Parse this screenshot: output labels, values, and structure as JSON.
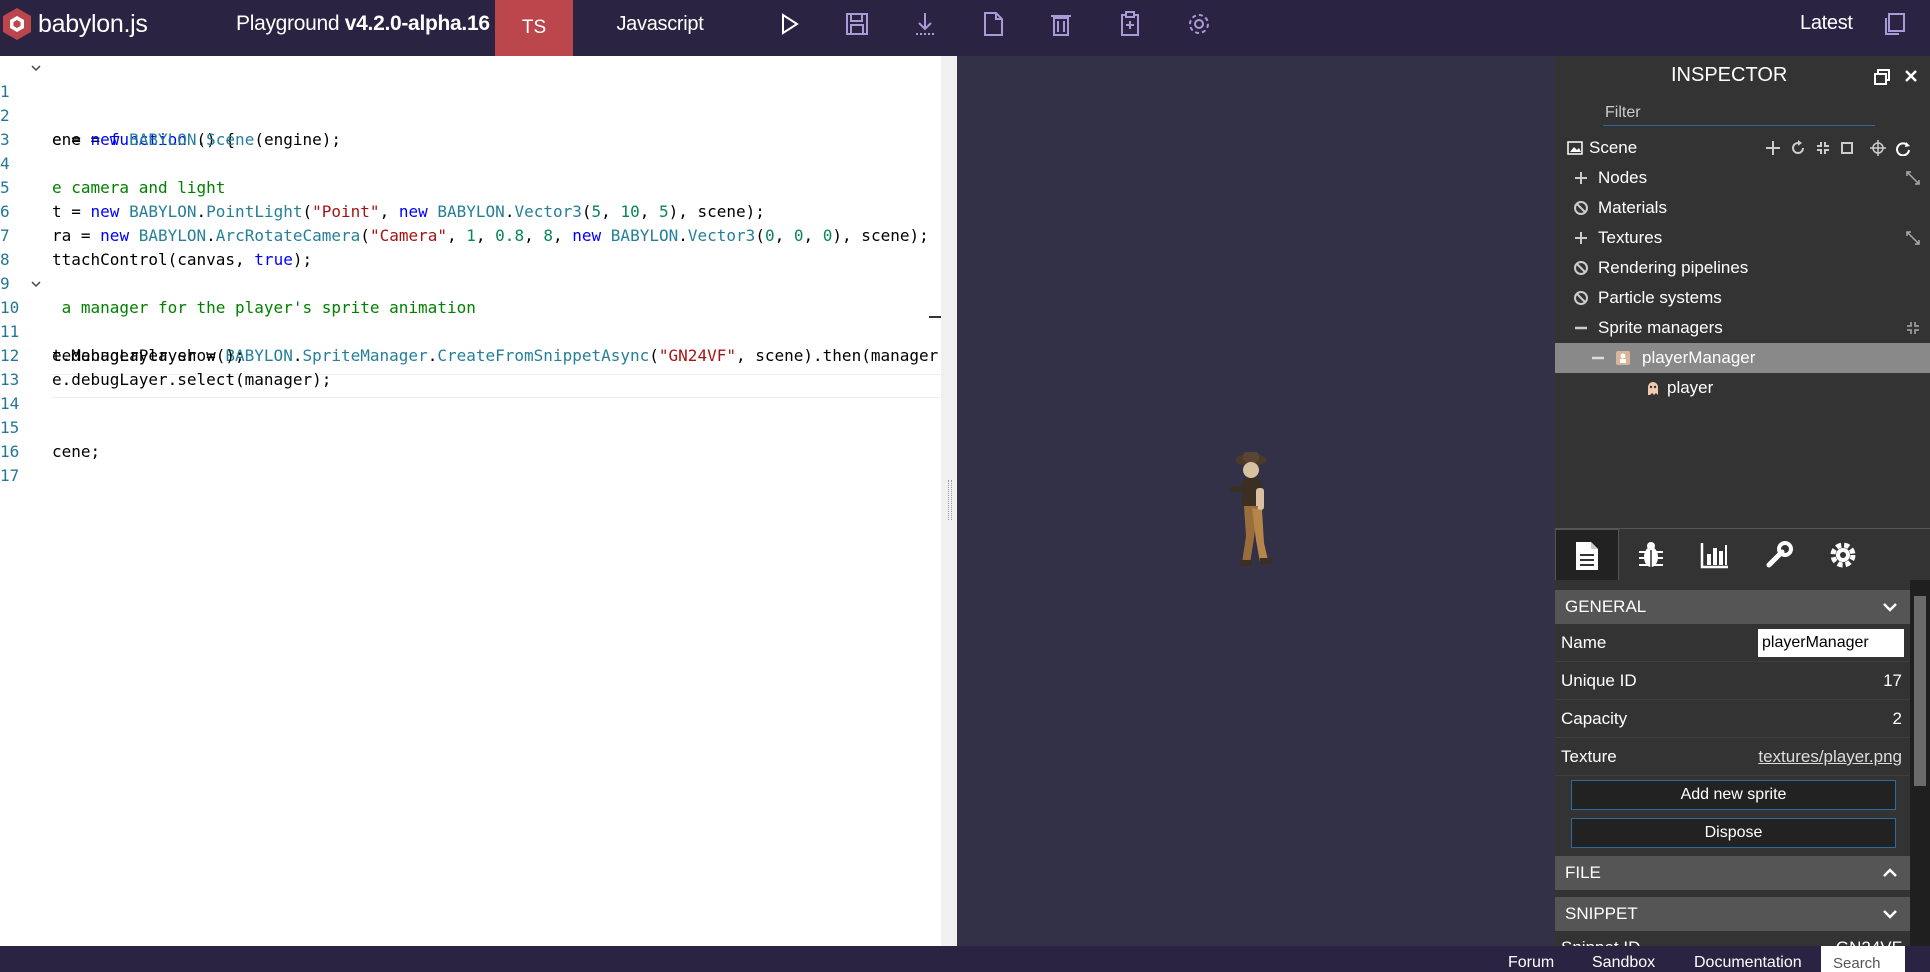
{
  "topbar": {
    "logo_text": "babylon.js",
    "title_prefix": "Playground ",
    "title_version": "v4.2.0-alpha.16",
    "tab_ts": "TS",
    "tab_js": "Javascript",
    "latest": "Latest",
    "icons": [
      "play-icon",
      "save-icon",
      "download-icon",
      "new-file-icon",
      "clear-icon",
      "examples-icon",
      "settings-icon",
      "copy-icon"
    ]
  },
  "editor": {
    "lines": [
      {
        "n": "1",
        "fold": true
      },
      {
        "n": "2",
        "fold": false
      },
      {
        "n": "3",
        "fold": false
      },
      {
        "n": "4",
        "fold": false
      },
      {
        "n": "5",
        "fold": false
      },
      {
        "n": "6",
        "fold": false
      },
      {
        "n": "7",
        "fold": false
      },
      {
        "n": "8",
        "fold": false
      },
      {
        "n": "9",
        "fold": false
      },
      {
        "n": "10",
        "fold": true
      },
      {
        "n": "11",
        "fold": false
      },
      {
        "n": "12",
        "fold": false
      },
      {
        "n": "13",
        "fold": false
      },
      {
        "n": "14",
        "fold": false
      },
      {
        "n": "15",
        "fold": false
      },
      {
        "n": "16",
        "fold": false
      },
      {
        "n": "17",
        "fold": false
      }
    ],
    "code": {
      "l1a": "ene = ",
      "l1b": "function",
      "l1c": " () {",
      "l2a": "e = ",
      "l2b": "new",
      "l2c": " ",
      "l2d": "BABYLON",
      "l2e": ".",
      "l2f": "Scene",
      "l2g": "(engine);",
      "l4": "e camera and light",
      "l5a": "t = ",
      "l5b": "new",
      "l5c": " ",
      "l5d": "BABYLON",
      "l5e": ".",
      "l5f": "PointLight",
      "l5g": "(",
      "l5h": "\"Point\"",
      "l5i": ", ",
      "l5j": "new",
      "l5k": " ",
      "l5l": "BABYLON",
      "l5m": ".",
      "l5n": "Vector3",
      "l5o": "(",
      "l5p": "5",
      "l5q": ", ",
      "l5r": "10",
      "l5s": ", ",
      "l5t": "5",
      "l5u": "), scene);",
      "l6a": "ra = ",
      "l6b": "new",
      "l6c": " ",
      "l6d": "BABYLON",
      "l6e": ".",
      "l6f": "ArcRotateCamera",
      "l6g": "(",
      "l6h": "\"Camera\"",
      "l6i": ", ",
      "l6j": "1",
      "l6k": ", ",
      "l6l": "0.8",
      "l6m": ", ",
      "l6n": "8",
      "l6o": ", ",
      "l6p": "new",
      "l6q": " ",
      "l6r": "BABYLON",
      "l6s": ".",
      "l6t": "Vector3",
      "l6u": "(",
      "l6v": "0",
      "l6w": ", ",
      "l6x": "0",
      "l6y": ", ",
      "l6z": "0",
      "l6zz": "), scene);",
      "l7a": "ttachControl(canvas, ",
      "l7b": "true",
      "l7c": ");",
      "l9": " a manager for the player's sprite animation",
      "l10a": "teManagerPlayer = ",
      "l10b": "BABYLON",
      "l10c": ".",
      "l10d": "SpriteManager",
      "l10e": ".",
      "l10f": "CreateFromSnippetAsync",
      "l10g": "(",
      "l10h": "\"GN24VF\"",
      "l10i": ", scene).then(manager",
      "l11": "e.debugLayer.show();",
      "l12": "e.debugLayer.select(manager);",
      "l15": "cene;"
    }
  },
  "inspector": {
    "title": "INSPECTOR",
    "filter_placeholder": "Filter",
    "tree": [
      {
        "label": "Scene"
      },
      {
        "label": "Nodes"
      },
      {
        "label": "Materials"
      },
      {
        "label": "Textures"
      },
      {
        "label": "Rendering pipelines"
      },
      {
        "label": "Particle systems"
      },
      {
        "label": "Sprite managers"
      },
      {
        "label": "playerManager"
      },
      {
        "label": "player"
      }
    ],
    "tabs": [
      "properties-tab-icon",
      "debug-tab-icon",
      "statistics-tab-icon",
      "tools-tab-icon",
      "settings-tab-icon"
    ],
    "general": {
      "header": "GENERAL",
      "name_label": "Name",
      "name_value": "playerManager",
      "uid_label": "Unique ID",
      "uid_value": "17",
      "capacity_label": "Capacity",
      "capacity_value": "2",
      "texture_label": "Texture",
      "texture_value": "textures/player.png",
      "add_sprite": "Add new sprite",
      "dispose": "Dispose"
    },
    "file_header": "FILE",
    "snippet_header": "SNIPPET",
    "snippet_partial": "Snippet ID",
    "snippet_value_partial": "GN24VF"
  },
  "footer": {
    "forum": "Forum",
    "sandbox": "Sandbox",
    "documentation": "Documentation",
    "search": "Search"
  },
  "colors": {
    "topbar": "#2a2342",
    "ts_tab": "#bb464b",
    "viewport": "#333148",
    "inspector": "#333333",
    "selected_row": "#898989"
  }
}
